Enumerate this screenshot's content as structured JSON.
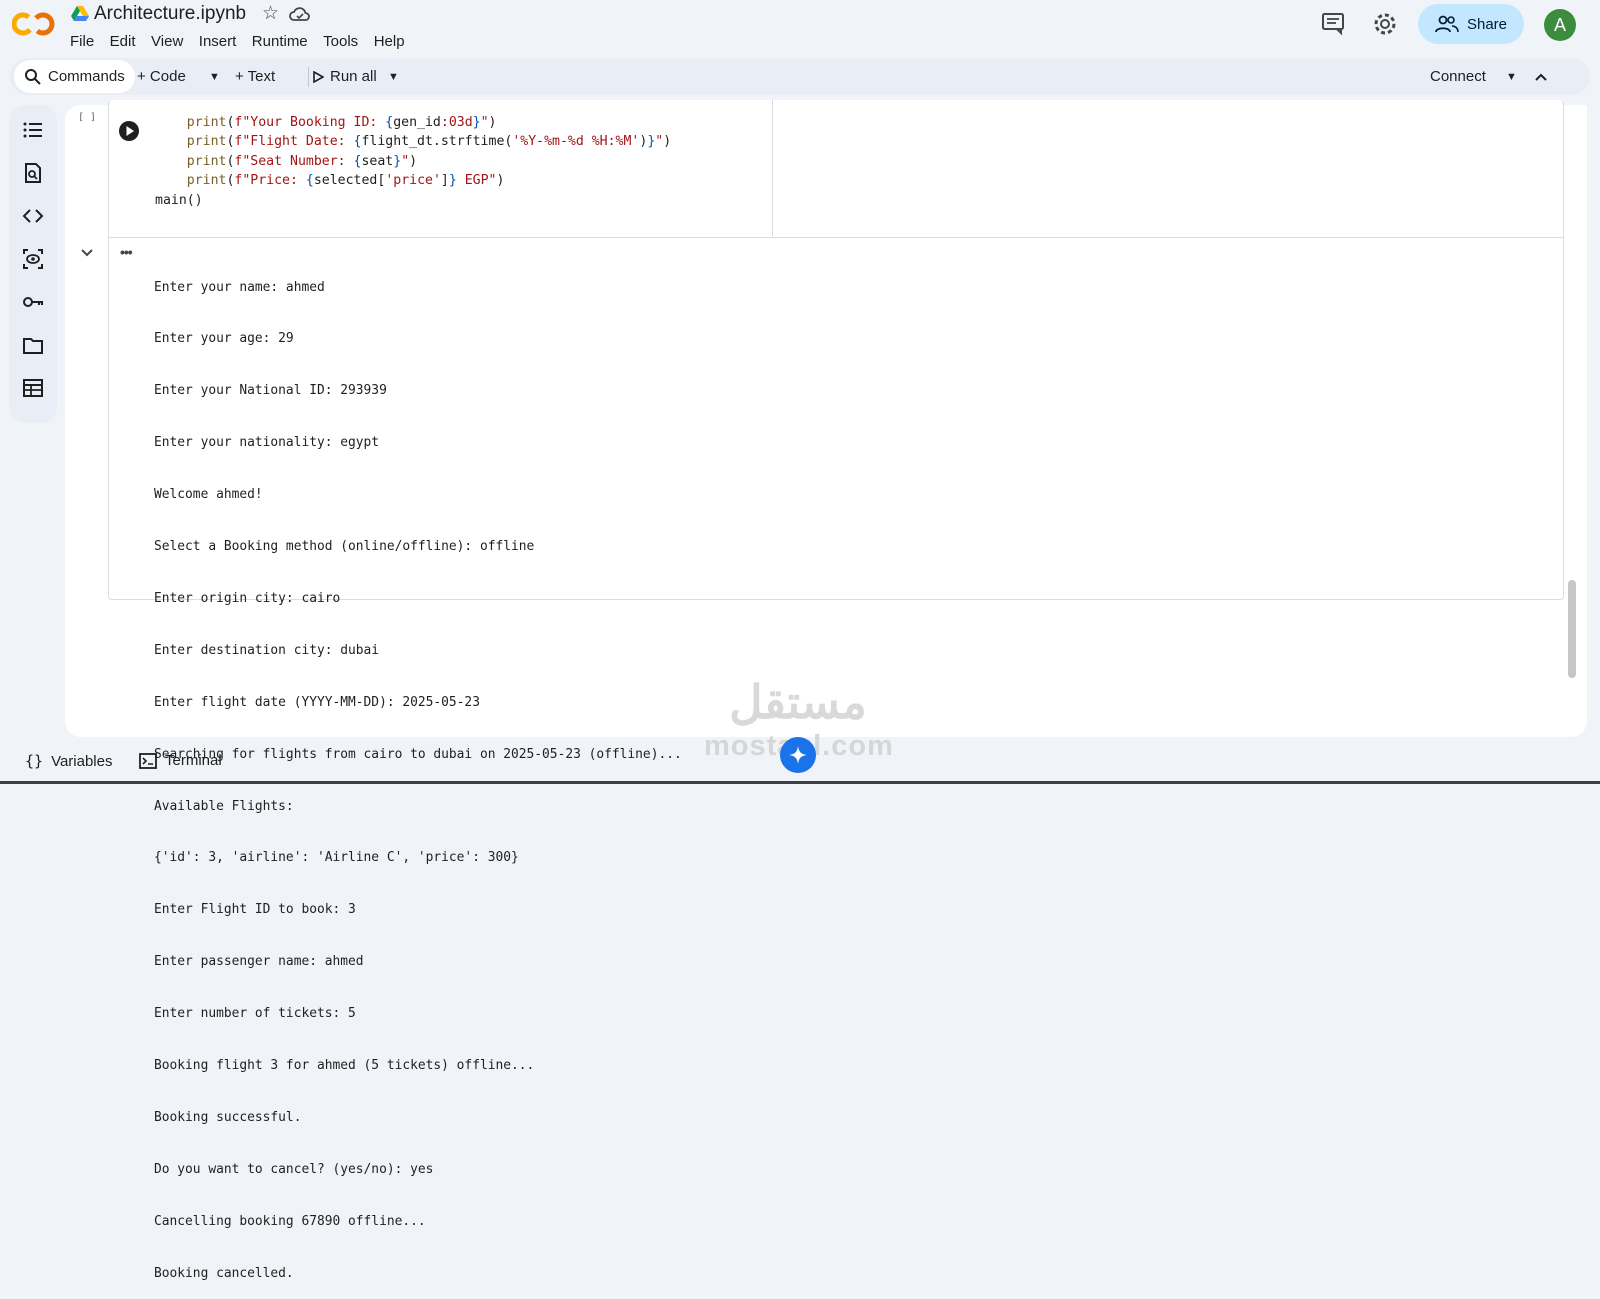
{
  "header": {
    "filename": "Architecture.ipynb",
    "menu": [
      "File",
      "Edit",
      "View",
      "Insert",
      "Runtime",
      "Tools",
      "Help"
    ],
    "share_label": "Share",
    "avatar_letter": "A"
  },
  "toolbar": {
    "commands_label": "Commands",
    "code_label": "+ Code",
    "text_label": "+ Text",
    "run_all_label": "Run all",
    "connect_label": "Connect"
  },
  "cell": {
    "execution_count": "[ ]",
    "code_lines": [
      "    print(f\"Your Booking ID: {gen_id:03d}\")",
      "    print(f\"Flight Date: {flight_dt.strftime('%Y-%m-%d %H:%M')}\")",
      "    print(f\"Seat Number: {seat}\")",
      "    print(f\"Price: {selected['price']} EGP\")",
      "main()"
    ],
    "output_lines": [
      "Enter your name: ahmed",
      "Enter your age: 29",
      "Enter your National ID: 293939",
      "Enter your nationality: egypt",
      "Welcome ahmed!",
      "Select a Booking method (online/offline): offline",
      "Enter origin city: cairo",
      "Enter destination city: dubai",
      "Enter flight date (YYYY-MM-DD): 2025-05-23",
      "Searching for flights from cairo to dubai on 2025-05-23 (offline)...",
      "Available Flights:",
      "{'id': 3, 'airline': 'Airline C', 'price': 300}",
      "Enter Flight ID to book: 3",
      "Enter passenger name: ahmed",
      "Enter number of tickets: 5",
      "Booking flight 3 for ahmed (5 tickets) offline...",
      "Booking successful.",
      "Do you want to cancel? (yes/no): yes",
      "Cancelling booking 67890 offline...",
      "Booking cancelled."
    ]
  },
  "watermark": {
    "arabic": "مستقل",
    "latin": "mostaql.com"
  },
  "footer": {
    "variables_label": "Variables",
    "terminal_label": "Terminal"
  },
  "icons": {
    "colab_logo": "colab-logo",
    "drive": "google-drive-icon",
    "star": "star-icon",
    "cloud": "cloud-icon",
    "comments": "comment-icon",
    "settings": "gear-icon",
    "share": "people-icon",
    "search": "search-icon",
    "run": "play-icon",
    "rail": [
      "toc-icon",
      "find-icon",
      "code-snippets-icon",
      "variables-inspector-icon",
      "key-icon",
      "folder-icon",
      "table-icon"
    ]
  },
  "colors": {
    "share_bg": "#c2e7ff",
    "surface": "#f0f4f9",
    "avatar": "#3b8d3d",
    "colab_orange": "#f9ab00"
  }
}
